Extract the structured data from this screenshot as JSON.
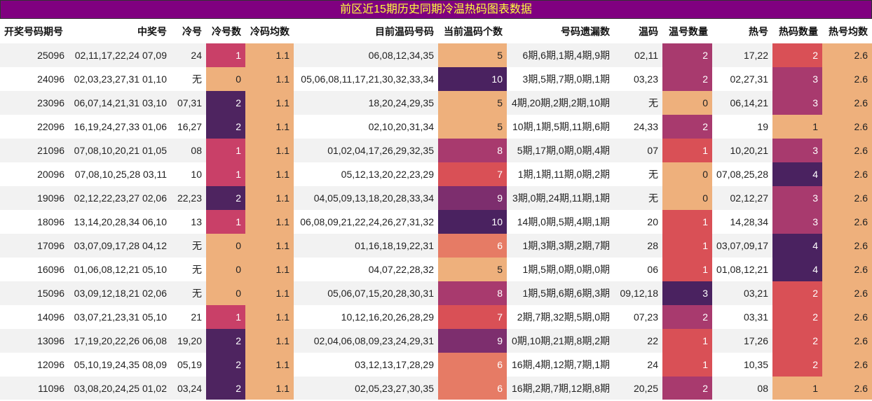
{
  "chart_data": {
    "type": "table",
    "title": "前区近15期历史同期冷温热码图表数据",
    "columns": [
      "开奖号码期号",
      "中奖号",
      "冷号",
      "冷号数",
      "冷码均数",
      "目前温码号码",
      "当前温码个数",
      "号码遗漏数",
      "温码",
      "温号数量",
      "热号",
      "热码数量",
      "热号均数"
    ],
    "rows": [
      [
        "25096",
        "02,11,17,22,24 07,09",
        "24",
        "1",
        "1.1",
        "06,08,12,34,35",
        "5",
        "6期,6期,1期,4期,9期",
        "02,11",
        "2",
        "17,22",
        "2",
        "2.6"
      ],
      [
        "24096",
        "02,03,23,27,31 01,10",
        "无",
        "0",
        "1.1",
        "05,06,08,11,17,21,30,32,33,34",
        "10",
        "3期,5期,7期,0期,1期",
        "03,23",
        "2",
        "02,27,31",
        "3",
        "2.6"
      ],
      [
        "23096",
        "06,07,14,21,31 03,10",
        "07,31",
        "2",
        "1.1",
        "18,20,24,29,35",
        "5",
        "4期,20期,2期,2期,10期",
        "无",
        "0",
        "06,14,21",
        "3",
        "2.6"
      ],
      [
        "22096",
        "16,19,24,27,33 01,06",
        "16,27",
        "2",
        "1.1",
        "02,10,20,31,34",
        "5",
        "10期,1期,5期,11期,6期",
        "24,33",
        "2",
        "19",
        "1",
        "2.6"
      ],
      [
        "21096",
        "07,08,10,20,21 01,05",
        "08",
        "1",
        "1.1",
        "01,02,04,17,26,29,32,35",
        "8",
        "5期,17期,0期,0期,4期",
        "07",
        "1",
        "10,20,21",
        "3",
        "2.6"
      ],
      [
        "20096",
        "07,08,10,25,28 03,11",
        "10",
        "1",
        "1.1",
        "05,12,13,20,22,23,29",
        "7",
        "1期,1期,11期,0期,2期",
        "无",
        "0",
        "07,08,25,28",
        "4",
        "2.6"
      ],
      [
        "19096",
        "02,12,22,23,27 02,06",
        "22,23",
        "2",
        "1.1",
        "04,05,09,13,18,20,28,33,34",
        "9",
        "3期,0期,24期,11期,1期",
        "无",
        "0",
        "02,12,27",
        "3",
        "2.6"
      ],
      [
        "18096",
        "13,14,20,28,34 06,10",
        "13",
        "1",
        "1.1",
        "06,08,09,21,22,24,26,27,31,32",
        "10",
        "14期,0期,5期,4期,1期",
        "20",
        "1",
        "14,28,34",
        "3",
        "2.6"
      ],
      [
        "17096",
        "03,07,09,17,28 04,12",
        "无",
        "0",
        "1.1",
        "01,16,18,19,22,31",
        "6",
        "1期,3期,3期,2期,7期",
        "28",
        "1",
        "03,07,09,17",
        "4",
        "2.6"
      ],
      [
        "16096",
        "01,06,08,12,21 05,10",
        "无",
        "0",
        "1.1",
        "04,07,22,28,32",
        "5",
        "1期,5期,0期,0期,0期",
        "06",
        "1",
        "01,08,12,21",
        "4",
        "2.6"
      ],
      [
        "15096",
        "03,09,12,18,21 02,06",
        "无",
        "0",
        "1.1",
        "05,06,07,15,20,28,30,31",
        "8",
        "1期,5期,6期,6期,3期",
        "09,12,18",
        "3",
        "03,21",
        "2",
        "2.6"
      ],
      [
        "14096",
        "03,07,21,23,31 05,10",
        "21",
        "1",
        "1.1",
        "10,12,16,20,26,28,29",
        "7",
        "2期,7期,32期,5期,0期",
        "07,23",
        "2",
        "03,31",
        "2",
        "2.6"
      ],
      [
        "13096",
        "17,19,20,22,26 06,08",
        "19,20",
        "2",
        "1.1",
        "02,04,06,08,09,23,24,29,31",
        "9",
        "0期,10期,21期,8期,2期",
        "22",
        "1",
        "17,26",
        "2",
        "2.6"
      ],
      [
        "12096",
        "05,10,19,24,35 08,09",
        "05,19",
        "2",
        "1.1",
        "03,12,13,17,28,29",
        "6",
        "16期,4期,12期,7期,1期",
        "24",
        "1",
        "10,35",
        "2",
        "2.6"
      ],
      [
        "11096",
        "03,08,20,24,25 01,02",
        "03,24",
        "2",
        "1.1",
        "02,05,23,27,30,35",
        "6",
        "16期,2期,7期,12期,8期",
        "20,25",
        "2",
        "08",
        "1",
        "2.6"
      ]
    ],
    "heat_columns": [
      "冷号数",
      "当前温码个数",
      "温号数量",
      "热码数量"
    ],
    "constant_columns": [
      "冷码均数",
      "热号均数"
    ],
    "colors": {
      "冷号数": {
        "0": "#eeb07c",
        "1": "#c94068",
        "2": "#4e2460"
      },
      "温号数量": {
        "0": "#eeb07c",
        "1": "#d95056",
        "2": "#a83a6e",
        "3": "#4a2260"
      },
      "热码数量": {
        "1": "#eeb07c",
        "2": "#d95056",
        "3": "#a83a6e",
        "4": "#4a2260"
      },
      "当前温码个数": {
        "5": "#eeb07c",
        "6": "#e67b65",
        "7": "#d95056",
        "8": "#a83a6e",
        "9": "#7d2e6e",
        "10": "#4a2260"
      },
      "constant": "#eeb07c",
      "title_bg": "#800080",
      "title_text": "#ffff3c"
    }
  }
}
